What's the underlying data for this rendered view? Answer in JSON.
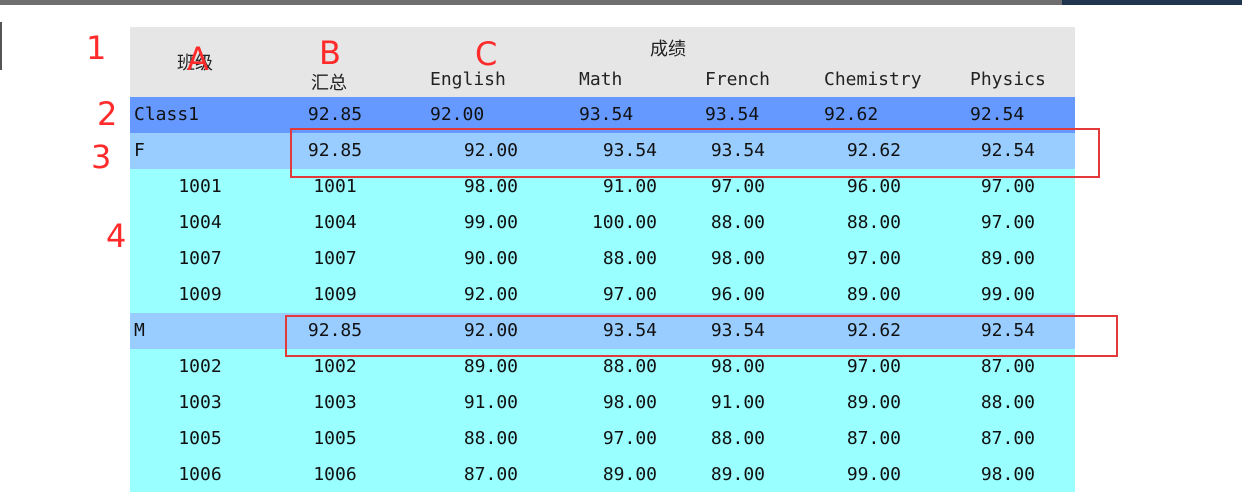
{
  "annotations": {
    "row_labels": [
      "1",
      "2",
      "3",
      "4"
    ],
    "column_labels": [
      "A",
      "B",
      "C"
    ]
  },
  "header": {
    "group_title": "成绩",
    "col_class": "班级",
    "col_total": "汇总",
    "subjects": [
      "English",
      "Math",
      "French",
      "Chemistry",
      "Physics"
    ]
  },
  "class_row": {
    "name": "Class1",
    "total": "92.85",
    "scores": [
      "92.00",
      "93.54",
      "93.54",
      "92.62",
      "92.54"
    ]
  },
  "groups": [
    {
      "name": "F",
      "total": "92.85",
      "scores": [
        "92.00",
        "93.54",
        "93.54",
        "92.62",
        "92.54"
      ],
      "students": [
        {
          "id": "1001",
          "total": "1001",
          "scores": [
            "98.00",
            "91.00",
            "97.00",
            "96.00",
            "97.00"
          ]
        },
        {
          "id": "1004",
          "total": "1004",
          "scores": [
            "99.00",
            "100.00",
            "88.00",
            "88.00",
            "97.00"
          ]
        },
        {
          "id": "1007",
          "total": "1007",
          "scores": [
            "90.00",
            "88.00",
            "98.00",
            "97.00",
            "89.00"
          ]
        },
        {
          "id": "1009",
          "total": "1009",
          "scores": [
            "92.00",
            "97.00",
            "96.00",
            "89.00",
            "99.00"
          ]
        }
      ]
    },
    {
      "name": "M",
      "total": "92.85",
      "scores": [
        "92.00",
        "93.54",
        "93.54",
        "92.62",
        "92.54"
      ],
      "students": [
        {
          "id": "1002",
          "total": "1002",
          "scores": [
            "89.00",
            "88.00",
            "98.00",
            "97.00",
            "87.00"
          ]
        },
        {
          "id": "1003",
          "total": "1003",
          "scores": [
            "91.00",
            "98.00",
            "91.00",
            "89.00",
            "88.00"
          ]
        },
        {
          "id": "1005",
          "total": "1005",
          "scores": [
            "88.00",
            "97.00",
            "88.00",
            "87.00",
            "87.00"
          ]
        },
        {
          "id": "1006",
          "total": "1006",
          "scores": [
            "87.00",
            "89.00",
            "89.00",
            "99.00",
            "98.00"
          ]
        }
      ]
    }
  ],
  "colors": {
    "class_row": "#6699ff",
    "group_row": "#99ccff",
    "detail_row": "#99ffff",
    "header": "#e6e6e6",
    "annotation": "#ff2a2a"
  }
}
